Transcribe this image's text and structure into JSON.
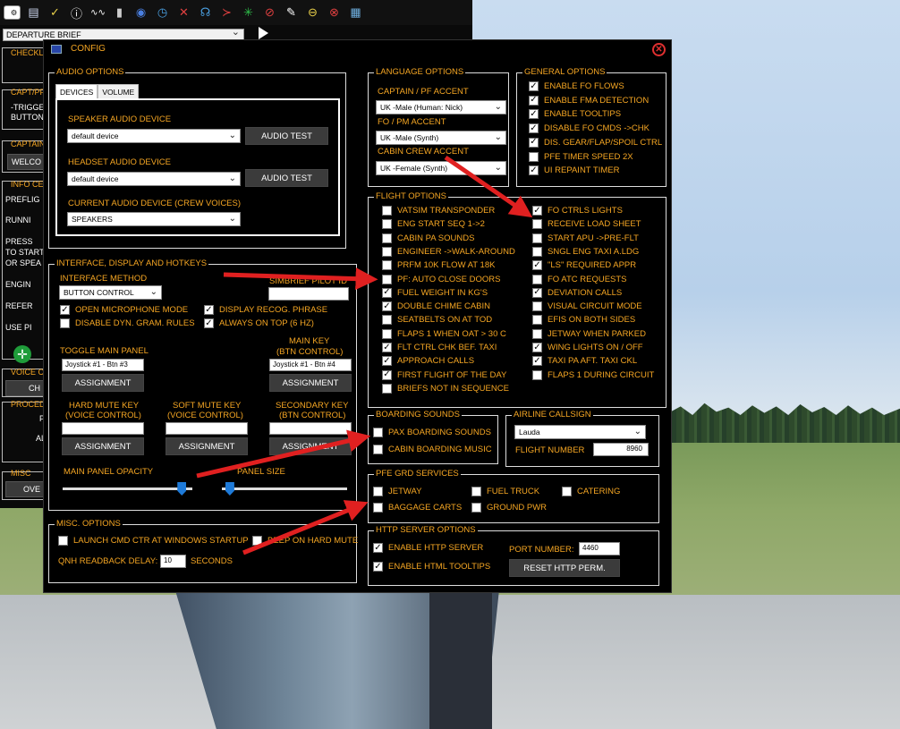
{
  "toolbar": {
    "icons": [
      "home-icon",
      "gear-icon",
      "clipboard-icon",
      "checklist-icon",
      "info-icon",
      "route-icon",
      "fuel-icon",
      "pause-icon",
      "clock-icon",
      "tools-icon",
      "headset-icon",
      "signal-icon",
      "loading-icon",
      "stop-icon",
      "pin-icon",
      "minus-icon",
      "close-icon",
      "qr-icon"
    ]
  },
  "left_panel": {
    "brief_select": "DEPARTURE BRIEF",
    "checklist": "CHECKL",
    "capt_pf": "CAPT/PF",
    "trigger": "-TRIGGE",
    "button": "BUTTON",
    "captain": "CAPTAIN",
    "welcome_btn": "WELCO",
    "info_center": "INFO CE",
    "preflight": "PREFLIG",
    "running": "RUNNI",
    "press": "PRESS",
    "to_start": "TO START",
    "or_speak": "OR SPEA",
    "engine": "ENGIN",
    "refer": "REFER",
    "use_p": "USE PI",
    "voice_c": "VOICE C",
    "ch": "CH",
    "procedures": "PROCED",
    "p": "P",
    "al": "AL",
    "misc": "MISC",
    "ove": "OVE"
  },
  "dialog": {
    "title": "CONFIG",
    "audio": {
      "group_label": "AUDIO OPTIONS",
      "tab_devices": "DEVICES",
      "tab_volume": "VOLUME",
      "speaker_label": "SPEAKER AUDIO DEVICE",
      "speaker_value": "default device",
      "audio_test": "AUDIO TEST",
      "headset_label": "HEADSET AUDIO DEVICE",
      "headset_value": "default device",
      "current_label": "CURRENT AUDIO DEVICE (CREW VOICES)",
      "current_value": "SPEAKERS"
    },
    "language": {
      "group_label": "LANGUAGE OPTIONS",
      "captain_label": "CAPTAIN / PF ACCENT",
      "captain_value": "UK -Male (Human: Nick)",
      "fo_label": "FO / PM ACCENT",
      "fo_value": "UK -Male (Synth)",
      "cabin_label": "CABIN CREW ACCENT",
      "cabin_value": "UK -Female (Synth)"
    },
    "general": {
      "group_label": "GENERAL OPTIONS",
      "items": [
        {
          "label": "ENABLE FO FLOWS",
          "checked": true
        },
        {
          "label": "ENABLE FMA DETECTION",
          "checked": true
        },
        {
          "label": "ENABLE TOOLTIPS",
          "checked": true
        },
        {
          "label": "DISABLE FO CMDS ->CHK",
          "checked": true
        },
        {
          "label": "DIS. GEAR/FLAP/SPOIL CTRL",
          "checked": true
        },
        {
          "label": "PFE TIMER SPEED 2X",
          "checked": false
        },
        {
          "label": "UI REPAINT TIMER",
          "checked": true
        }
      ]
    },
    "flight": {
      "group_label": "FLIGHT OPTIONS",
      "left": [
        {
          "label": "VATSIM TRANSPONDER",
          "checked": false
        },
        {
          "label": "ENG START SEQ 1->2",
          "checked": false
        },
        {
          "label": "CABIN PA SOUNDS",
          "checked": false
        },
        {
          "label": "ENGINEER ->WALK-AROUND",
          "checked": false
        },
        {
          "label": "PRFM 10K FLOW AT 18K",
          "checked": false
        },
        {
          "label": "PF: AUTO CLOSE DOORS",
          "checked": false
        },
        {
          "label": "FUEL WEIGHT IN KG'S",
          "checked": true
        },
        {
          "label": "DOUBLE CHIME CABIN",
          "checked": true
        },
        {
          "label": "SEATBELTS ON AT TOD",
          "checked": false
        },
        {
          "label": "FLAPS 1 WHEN OAT > 30 C",
          "checked": false
        },
        {
          "label": "FLT CTRL CHK BEF. TAXI",
          "checked": true
        },
        {
          "label": "APPROACH CALLS",
          "checked": true
        },
        {
          "label": "FIRST FLIGHT OF THE DAY",
          "checked": true
        },
        {
          "label": "BRIEFS NOT IN SEQUENCE",
          "checked": false
        }
      ],
      "right": [
        {
          "label": "FO CTRLS LIGHTS",
          "checked": true
        },
        {
          "label": "RECEIVE LOAD SHEET",
          "checked": false
        },
        {
          "label": "START APU ->PRE-FLT",
          "checked": false
        },
        {
          "label": "SNGL ENG TAXI A.LDG",
          "checked": false
        },
        {
          "label": "\"LS\" REQUIRED APPR",
          "checked": true
        },
        {
          "label": "FO ATC REQUESTS",
          "checked": false
        },
        {
          "label": "DEVIATION CALLS",
          "checked": true
        },
        {
          "label": "VISUAL CIRCUIT MODE",
          "checked": false
        },
        {
          "label": "EFIS ON BOTH SIDES",
          "checked": false
        },
        {
          "label": "JETWAY WHEN PARKED",
          "checked": false
        },
        {
          "label": "WING LIGHTS ON / OFF",
          "checked": true
        },
        {
          "label": "TAXI PA AFT. TAXI CKL",
          "checked": true
        },
        {
          "label": "FLAPS 1 DURING CIRCUIT",
          "checked": false
        }
      ]
    },
    "interface": {
      "group_label": "INTERFACE, DISPLAY AND HOTKEYS",
      "method_label": "INTERFACE METHOD",
      "method_value": "BUTTON CONTROL",
      "simbrief_label": "SIMBRIEF PILOT ID",
      "simbrief_value": "",
      "open_mic": {
        "label": "OPEN MICROPHONE MODE",
        "checked": true
      },
      "display_recog": {
        "label": "DISPLAY  RECOG. PHRASE",
        "checked": true
      },
      "disable_dyn": {
        "label": "DISABLE DYN. GRAM. RULES",
        "checked": false
      },
      "always_top": {
        "label": "ALWAYS ON TOP (6 HZ)",
        "checked": true
      },
      "toggle_label": "TOGGLE MAIN PANEL",
      "toggle_value": "Joystick #1 - Btn #3",
      "main_key_label1": "MAIN KEY",
      "main_key_label2": "(BTN CONTROL)",
      "main_key_value": "Joystick #1 - Btn #4",
      "assignment": "ASSIGNMENT",
      "hard_mute_1": "HARD MUTE KEY",
      "hard_mute_2": "(VOICE CONTROL)",
      "soft_mute_1": "SOFT MUTE KEY",
      "soft_mute_2": "(VOICE CONTROL)",
      "secondary_1": "SECONDARY KEY",
      "secondary_2": "(BTN CONTROL)",
      "opacity_label": "MAIN PANEL OPACITY",
      "opacity_level": 0.95,
      "size_label": "PANEL SIZE",
      "size_level": 0.03
    },
    "boarding": {
      "group_label": "BOARDING SOUNDS",
      "pax": {
        "label": "PAX BOARDING SOUNDS",
        "checked": false
      },
      "music": {
        "label": "CABIN BOARDING MUSIC",
        "checked": false
      }
    },
    "callsign": {
      "group_label": "AIRLINE CALLSIGN",
      "airline_value": "Lauda",
      "flight_number_label": "FLIGHT NUMBER",
      "flight_number_value": "8960"
    },
    "pfe": {
      "group_label": "PFE GRD SERVICES",
      "jetway": {
        "label": "JETWAY",
        "checked": false
      },
      "fuel_truck": {
        "label": "FUEL TRUCK",
        "checked": false
      },
      "catering": {
        "label": "CATERING",
        "checked": false
      },
      "baggage": {
        "label": "BAGGAGE CARTS",
        "checked": false
      },
      "ground_pwr": {
        "label": "GROUND PWR",
        "checked": false
      }
    },
    "misc": {
      "group_label": "MISC. OPTIONS",
      "launch": {
        "label": "LAUNCH CMD CTR AT WINDOWS STARTUP",
        "checked": false
      },
      "beep": {
        "label": "BEEP ON HARD MUTE",
        "checked": false
      },
      "qnh_label": "QNH READBACK DELAY:",
      "qnh_value": "10",
      "seconds": "SECONDS"
    },
    "http": {
      "group_label": "HTTP SERVER OPTIONS",
      "enable_server": {
        "label": "ENABLE HTTP SERVER",
        "checked": true
      },
      "enable_tooltips": {
        "label": "ENABLE HTML TOOLTIPS",
        "checked": true
      },
      "port_label": "PORT NUMBER:",
      "port_value": "4460",
      "reset": "RESET HTTP PERM."
    }
  },
  "colors": {
    "accent": "#f5a623",
    "arrow": "#e02020",
    "slider": "#1e7ad8"
  }
}
